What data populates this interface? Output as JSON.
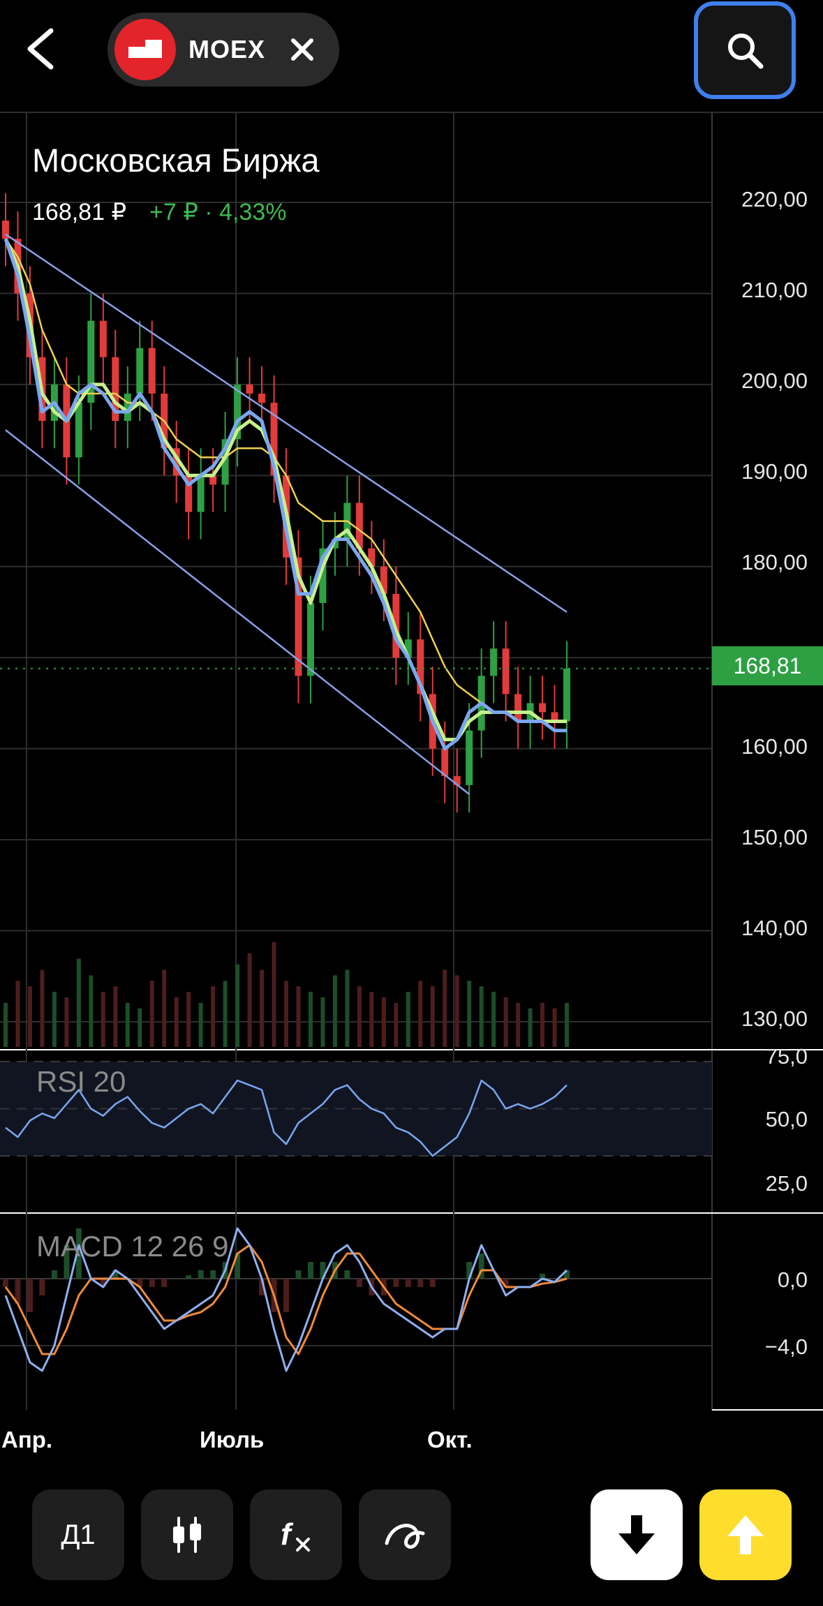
{
  "header": {
    "ticker": "MOEX",
    "back_icon": "chevron-left-icon",
    "close_icon": "close-icon",
    "search_icon": "search-icon"
  },
  "instrument": {
    "name": "Московская Биржа",
    "price": "168,81 ₽",
    "change": "+7 ₽ · 4,33%"
  },
  "price_axis": {
    "labels": [
      "220,00",
      "210,00",
      "200,00",
      "190,00",
      "180,00",
      "160,00",
      "150,00",
      "140,00",
      "130,00"
    ],
    "current": "168,81"
  },
  "indicators": {
    "rsi": {
      "title": "RSI 20",
      "labels": [
        "75,0",
        "50,0",
        "25,0"
      ]
    },
    "macd": {
      "title": "MACD 12 26 9",
      "labels": [
        "0,0",
        "−4,0"
      ]
    }
  },
  "time_axis": {
    "labels": [
      "Апр.",
      "Июль",
      "Окт."
    ]
  },
  "toolbar": {
    "period": "Д1",
    "candles_icon": "candlestick-icon",
    "indicators_icon": "function-icon",
    "draw_icon": "drawing-tool-icon",
    "sell_icon": "arrow-down-icon",
    "buy_icon": "arrow-up-icon"
  },
  "colors": {
    "up": "#2ea043",
    "down": "#e23b3b",
    "channel": "#8aa0e8",
    "ma_fast": "#7aa7f0",
    "ma_mid": "#c7f08a",
    "ma_slow": "#f0d050",
    "macd_line": "#8fb0f0",
    "signal_line": "#f08a3a",
    "accent": "#3e80ee",
    "buy": "#ffdd2d"
  },
  "chart_data": {
    "type": "candlestick",
    "ylim": [
      128,
      226
    ],
    "current_price": 168.81,
    "closes": [
      216,
      210,
      203,
      196,
      200,
      192,
      198,
      207,
      203,
      196,
      199,
      204,
      199,
      193,
      190,
      186,
      190,
      189,
      194,
      200,
      199,
      198,
      190,
      181,
      168,
      176,
      182,
      183,
      187,
      182,
      180,
      177,
      170,
      172,
      166,
      160,
      157,
      156,
      162,
      168,
      171,
      166,
      163,
      165,
      164,
      163,
      168.81
    ],
    "ma_fast": [
      216,
      212,
      205,
      197,
      198,
      196,
      199,
      200,
      199,
      197,
      197,
      199,
      197,
      193,
      191,
      189,
      190,
      191,
      193,
      196,
      197,
      196,
      191,
      184,
      177,
      177,
      181,
      183,
      183,
      181,
      179,
      176,
      172,
      170,
      167,
      163,
      160,
      161,
      164,
      165,
      164,
      164,
      163,
      163,
      163,
      162,
      162
    ],
    "ma_mid": [
      216,
      213,
      207,
      199,
      197,
      196,
      198,
      200,
      200,
      198,
      197,
      198,
      197,
      194,
      192,
      190,
      190,
      190,
      192,
      195,
      196,
      195,
      192,
      186,
      179,
      176,
      180,
      183,
      184,
      182,
      180,
      177,
      173,
      170,
      167,
      164,
      161,
      161,
      163,
      164,
      164,
      164,
      164,
      164,
      163,
      163,
      163
    ],
    "ma_slow": [
      216,
      214,
      211,
      206,
      203,
      200,
      199,
      199,
      199,
      199,
      198,
      198,
      197,
      196,
      194,
      193,
      192,
      192,
      192,
      193,
      193,
      193,
      192,
      190,
      187,
      186,
      185,
      185,
      185,
      184,
      183,
      181,
      179,
      177,
      175,
      172,
      169,
      167,
      166,
      165,
      164,
      164,
      163,
      163,
      163,
      163,
      163
    ],
    "rsi": [
      42,
      38,
      45,
      48,
      46,
      52,
      58,
      50,
      47,
      52,
      55,
      49,
      44,
      42,
      46,
      50,
      52,
      48,
      55,
      62,
      60,
      58,
      40,
      35,
      44,
      48,
      52,
      58,
      60,
      54,
      50,
      48,
      42,
      40,
      36,
      30,
      34,
      38,
      48,
      62,
      58,
      50,
      52,
      50,
      52,
      55,
      60
    ],
    "macd": [
      -1,
      -3,
      -5,
      -5.5,
      -4,
      -1,
      2,
      0,
      -0.5,
      0.5,
      0,
      -1,
      -2,
      -3,
      -2.5,
      -2,
      -1.5,
      -1,
      0.5,
      3,
      2,
      0,
      -3,
      -5.5,
      -4,
      -2,
      0,
      1.5,
      2,
      1,
      -0.5,
      -1.5,
      -2,
      -2.5,
      -3,
      -3.5,
      -3,
      -3,
      0,
      2,
      0.5,
      -1,
      -0.5,
      -0.5,
      0,
      -0.2,
      0.5
    ],
    "signal": [
      -0.5,
      -1.5,
      -3,
      -4.5,
      -4.5,
      -3,
      -1,
      0,
      0,
      0,
      0,
      -0.5,
      -1.5,
      -2.5,
      -2.5,
      -2.2,
      -2,
      -1.5,
      -0.5,
      1.5,
      2,
      1,
      -1,
      -3.5,
      -4.5,
      -3,
      -1,
      0.5,
      1.5,
      1.5,
      0.5,
      -0.5,
      -1.5,
      -2,
      -2.5,
      -3,
      -3,
      -3,
      -1,
      0.5,
      0.5,
      -0.5,
      -0.5,
      -0.5,
      -0.3,
      -0.2,
      0
    ],
    "volume": [
      40,
      60,
      55,
      70,
      50,
      45,
      80,
      65,
      50,
      55,
      40,
      35,
      60,
      70,
      45,
      50,
      40,
      55,
      60,
      75,
      85,
      70,
      95,
      60,
      55,
      50,
      45,
      65,
      70,
      55,
      50,
      45,
      40,
      50,
      60,
      55,
      70,
      65,
      60,
      55,
      50,
      45,
      40,
      35,
      40,
      35,
      40
    ],
    "channel_upper": [
      [
        216.5,
        0
      ],
      [
        175,
        46
      ]
    ],
    "channel_lower": [
      [
        195,
        0
      ],
      [
        155,
        38
      ]
    ]
  }
}
